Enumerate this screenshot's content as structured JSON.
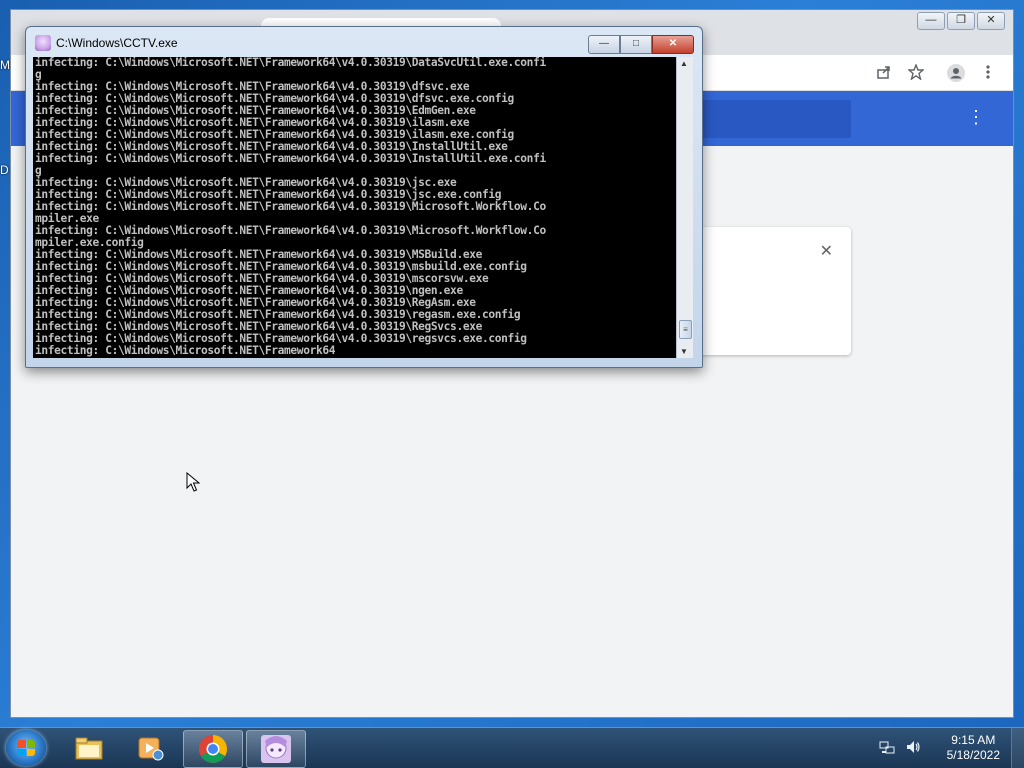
{
  "desktop": {
    "fragments": [
      "M",
      "D"
    ]
  },
  "browser": {
    "window_controls": {
      "minimize": "—",
      "maximize": "❐",
      "close": "✕"
    },
    "toolbar_icons": [
      "share-icon",
      "star-icon",
      "profile-icon",
      "kebab-menu-icon"
    ],
    "app_menu_glyph": "⋮",
    "card_close_glyph": "✕",
    "accent": "#3367d6"
  },
  "console": {
    "title": "C:\\Windows\\CCTV.exe",
    "buttons": {
      "minimize": "—",
      "maximize": "□",
      "close": "✕"
    },
    "lines": [
      "infecting: C:\\Windows\\Microsoft.NET\\Framework64\\v4.0.30319\\DataSvcUtil.exe.confi",
      "g",
      "infecting: C:\\Windows\\Microsoft.NET\\Framework64\\v4.0.30319\\dfsvc.exe",
      "infecting: C:\\Windows\\Microsoft.NET\\Framework64\\v4.0.30319\\dfsvc.exe.config",
      "infecting: C:\\Windows\\Microsoft.NET\\Framework64\\v4.0.30319\\EdmGen.exe",
      "infecting: C:\\Windows\\Microsoft.NET\\Framework64\\v4.0.30319\\ilasm.exe",
      "infecting: C:\\Windows\\Microsoft.NET\\Framework64\\v4.0.30319\\ilasm.exe.config",
      "infecting: C:\\Windows\\Microsoft.NET\\Framework64\\v4.0.30319\\InstallUtil.exe",
      "infecting: C:\\Windows\\Microsoft.NET\\Framework64\\v4.0.30319\\InstallUtil.exe.confi",
      "g",
      "infecting: C:\\Windows\\Microsoft.NET\\Framework64\\v4.0.30319\\jsc.exe",
      "infecting: C:\\Windows\\Microsoft.NET\\Framework64\\v4.0.30319\\jsc.exe.config",
      "infecting: C:\\Windows\\Microsoft.NET\\Framework64\\v4.0.30319\\Microsoft.Workflow.Co",
      "mpiler.exe",
      "infecting: C:\\Windows\\Microsoft.NET\\Framework64\\v4.0.30319\\Microsoft.Workflow.Co",
      "mpiler.exe.config",
      "infecting: C:\\Windows\\Microsoft.NET\\Framework64\\v4.0.30319\\MSBuild.exe",
      "infecting: C:\\Windows\\Microsoft.NET\\Framework64\\v4.0.30319\\msbuild.exe.config",
      "infecting: C:\\Windows\\Microsoft.NET\\Framework64\\v4.0.30319\\mscorsvw.exe",
      "infecting: C:\\Windows\\Microsoft.NET\\Framework64\\v4.0.30319\\ngen.exe",
      "infecting: C:\\Windows\\Microsoft.NET\\Framework64\\v4.0.30319\\RegAsm.exe",
      "infecting: C:\\Windows\\Microsoft.NET\\Framework64\\v4.0.30319\\regasm.exe.config",
      "infecting: C:\\Windows\\Microsoft.NET\\Framework64\\v4.0.30319\\RegSvcs.exe",
      "infecting: C:\\Windows\\Microsoft.NET\\Framework64\\v4.0.30319\\regsvcs.exe.config",
      "infecting: C:\\Windows\\Microsoft.NET\\Framework64"
    ],
    "text_color": "#c0c0c0",
    "background": "#000000"
  },
  "taskbar": {
    "items": [
      {
        "name": "start-button"
      },
      {
        "name": "file-explorer-icon"
      },
      {
        "name": "media-player-icon"
      },
      {
        "name": "chrome-icon"
      },
      {
        "name": "cctv-app-icon"
      }
    ],
    "clock": {
      "time": "9:15 AM",
      "date": "5/18/2022"
    }
  }
}
